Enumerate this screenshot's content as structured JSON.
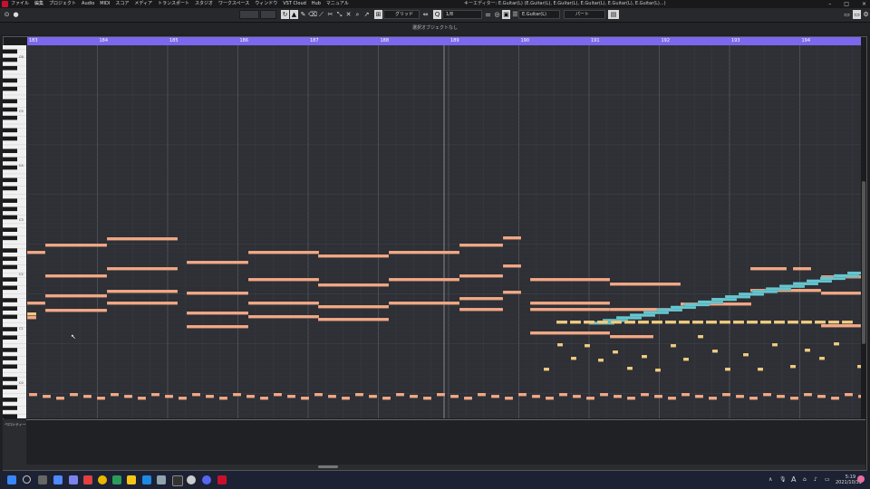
{
  "window": {
    "menu": [
      "ファイル",
      "編集",
      "プロジェクト",
      "Audio",
      "MIDI",
      "スコア",
      "メディア",
      "トランスポート",
      "スタジオ",
      "ワークスペース",
      "ウィンドウ",
      "VST Cloud",
      "Hub",
      "マニュアル"
    ],
    "title": "キーエディター: E.Guitar(L) (E.Guitar(L), E.Guitar(L), E.Guitar(L), E.Guitar(L), E.Guitar(L)...)",
    "controls": [
      "–",
      "□",
      "×"
    ]
  },
  "toolbar": {
    "grid_type": "グリッド",
    "quantize": "1/8",
    "track_name": "E.Guitar(L)",
    "part_mode": "パート"
  },
  "infobar": {
    "text": "選択オブジェクトなし"
  },
  "ruler": {
    "bars": [
      "183",
      "184",
      "185",
      "186",
      "187",
      "188",
      "189",
      "190",
      "191",
      "192",
      "193",
      "194"
    ]
  },
  "keyboard": {
    "c_labels": [
      "C6",
      "C5",
      "C4",
      "C3",
      "C2",
      "C1",
      "C0"
    ]
  },
  "controller": {
    "lane_label": "ベロシティー"
  },
  "taskbar": {
    "time": "5:19",
    "date": "2021/10/31",
    "ime": "A"
  },
  "colors": {
    "note_salmon": "#f2a987",
    "note_blue": "#67c6cf",
    "note_yellow": "#f2cc82",
    "ruler": "#7b68ee",
    "grid_bg": "#2e3036"
  }
}
